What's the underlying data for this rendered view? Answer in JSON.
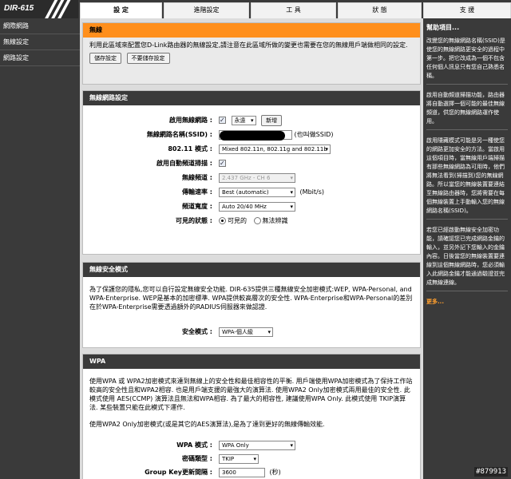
{
  "model": "DIR-615",
  "tabs": [
    {
      "label": "設  定",
      "active": true
    },
    {
      "label": "進階設定",
      "active": false
    },
    {
      "label": "工  具",
      "active": false
    },
    {
      "label": "狀  態",
      "active": false
    },
    {
      "label": "支  援",
      "active": false
    }
  ],
  "sidebar": {
    "items": [
      {
        "label": "網際網路"
      },
      {
        "label": "無線設定"
      },
      {
        "label": "網路設定"
      }
    ]
  },
  "wireless": {
    "title": "無線",
    "desc": "利用此區域來配置您D-Link路由器的無線設定,請注意在此區域所做的變更也需要在您的無線用戶端做相同的設定.",
    "save_label": "儲存設定",
    "nosave_label": "不要儲存設定"
  },
  "network": {
    "title": "無線網路設定",
    "enable_label": "啟用無線網路 :",
    "schedule_value": "永遠",
    "new_label": "新增",
    "ssid_label": "無線網路名稱(SSID) :",
    "ssid_note": "(也叫做SSID)",
    "mode_label": "802.11 模式 :",
    "mode_value": "Mixed 802.11n, 802.11g and 802.11b",
    "autoscan_label": "啟用自動頻道掃描 :",
    "channel_label": "無線頻道 :",
    "channel_value": "2.437 GHz - CH 6",
    "rate_label": "傳輸速率 :",
    "rate_value": "Best (automatic)",
    "rate_unit": "(Mbit/s)",
    "width_label": "頻道寬度 :",
    "width_value": "Auto 20/40 MHz",
    "visibility_label": "可見的狀態 :",
    "visible_label": "可見的",
    "invisible_label": "無法辨識"
  },
  "security": {
    "title": "無線安全模式",
    "desc": "為了保護您的隱私,您可以自行設定無線安全功能. DIR-635提供三種無線安全加密模式:WEP, WPA-Personal, and WPA-Enterprise. WEP是基本的加密標準. WPA提供較高層次的安全性. WPA-Enterprise和WPA-Personal的差別在於WPA-Enterprise需要透過額外的RADIUS伺服器來做認證.",
    "mode_label": "安全模式 :",
    "mode_value": "WPA-個人級"
  },
  "wpa": {
    "title": "WPA",
    "desc1": "使用WPA 或 WPA2加密模式來達到無線上的安全性和最佳相容性的平衡. 用戶端使用WPA加密模式為了保持工作站較高的安全性且和WPA2相容. 也是用戶端支援的最強大的演算法. 使用WPA2 Only加密模式兩用最佳的安全性. 此模式使用 AES(CCMP) 演算法且無法和WPA相容. 為了最大的相容性, 建議使用WPA Only. 此模式使用 TKIP演算法. 某些裝置只能在此模式下運作.",
    "desc2": "使用WPA2 Only加密模式(或是其它的AES演算法),是為了達到更好的無線傳輸效能.",
    "mode_label": "WPA 模式 :",
    "mode_value": "WPA Only",
    "cipher_label": "密碼類型 :",
    "cipher_value": "TKIP",
    "interval_label": "Group Key更新間隔 :",
    "interval_value": "3600",
    "interval_unit": "(秒)"
  },
  "help": {
    "title": "幫助項目...",
    "p1": "改變您的無線網路名稱(SSID)是使您的無線網路更安全的過程中第一步。把它改成為一個不包含任何個人訊息只有您自己熟悉名稱。",
    "p2": "啟用自動頻道掃描功能，路由器將自動選擇一個可能的最佳無線頻道，供您的無線網路運作使用。",
    "p3": "啟用隱藏模式可能是另一種使您的網路更加安全的方法。當啟用這個項目時，當無線用戶端掃描有那些無線網路為可用時，他們將無法看到(掃描到)您的無線網路。所以當您的無線裝置要連結至無線路由器時，您將需要在每個無線裝置上手動輸入您的無線網路名稱(SSID)。",
    "p4": "若您已經啟動無線安全加密功能，請確認您已完成網路金鑰的輸入，並另外記下您輸入的金鑰內容。日後當您的無線裝置要連線到這個無線網路時，您必須輸入此網路金鑰才能通過驗證並完成無線連線。",
    "more": "更多..."
  },
  "watermark": "#879913"
}
